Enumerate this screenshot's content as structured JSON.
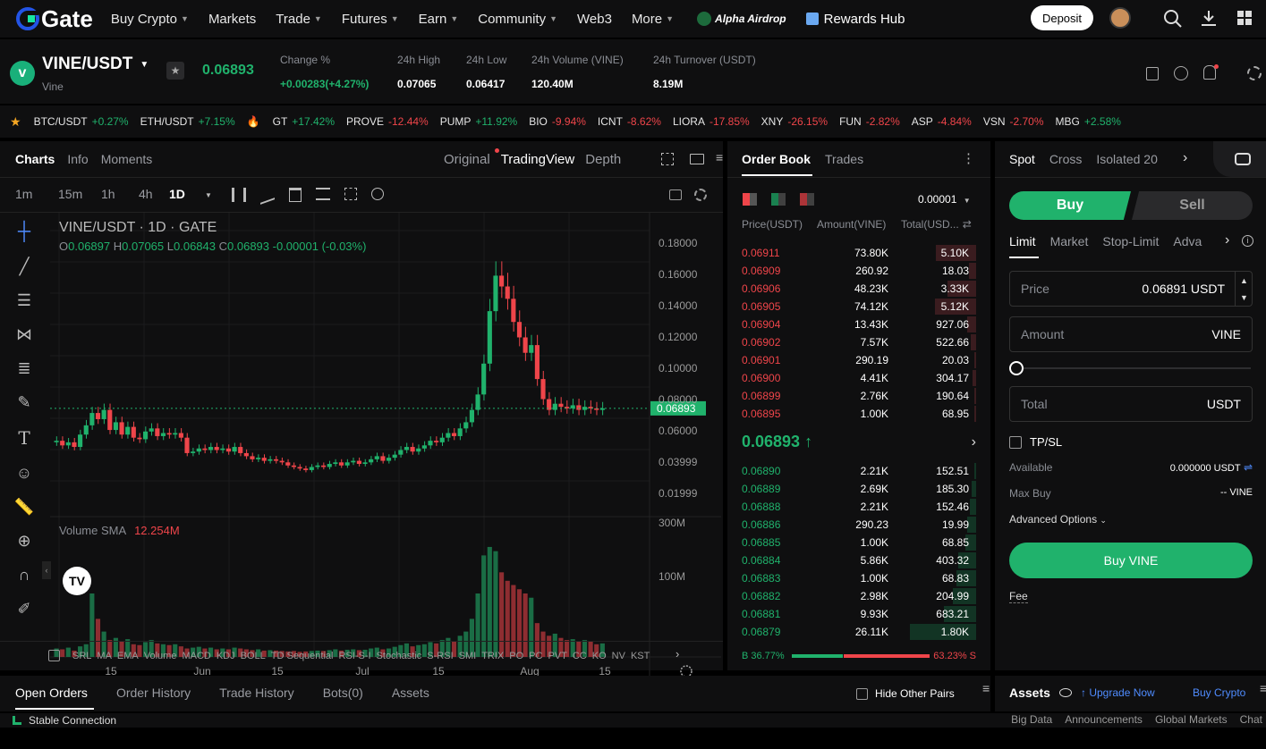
{
  "nav": {
    "logo": "Gate",
    "items": [
      {
        "label": "Buy Crypto",
        "caret": true
      },
      {
        "label": "Markets",
        "caret": false
      },
      {
        "label": "Trade",
        "caret": true
      },
      {
        "label": "Futures",
        "caret": true
      },
      {
        "label": "Earn",
        "caret": true
      },
      {
        "label": "Community",
        "caret": true
      },
      {
        "label": "Web3",
        "caret": false
      },
      {
        "label": "More",
        "caret": true
      }
    ],
    "alpha_airdrop": "Alpha Airdrop",
    "rewards_hub": "Rewards Hub",
    "deposit": "Deposit"
  },
  "pair": {
    "symbol": "VINE/USDT",
    "name": "Vine",
    "price": "0.06893",
    "stats": [
      {
        "label": "Change %",
        "value": "+0.00283(+4.27%)",
        "color": "green"
      },
      {
        "label": "24h High",
        "value": "0.07065",
        "color": "white"
      },
      {
        "label": "24h Low",
        "value": "0.06417",
        "color": "white"
      },
      {
        "label": "24h Volume (VINE)",
        "value": "120.40M",
        "color": "white"
      },
      {
        "label": "24h Turnover (USDT)",
        "value": "8.19M",
        "color": "white"
      }
    ]
  },
  "tickers": [
    {
      "sym": "BTC/USDT",
      "chg": "+0.27%",
      "up": true
    },
    {
      "sym": "ETH/USDT",
      "chg": "+7.15%",
      "up": true
    },
    {
      "sym": "GT",
      "chg": "+17.42%",
      "up": true
    },
    {
      "sym": "PROVE",
      "chg": "-12.44%",
      "up": false
    },
    {
      "sym": "PUMP",
      "chg": "+11.92%",
      "up": true
    },
    {
      "sym": "BIO",
      "chg": "-9.94%",
      "up": false
    },
    {
      "sym": "ICNT",
      "chg": "-8.62%",
      "up": false
    },
    {
      "sym": "LIORA",
      "chg": "-17.85%",
      "up": false
    },
    {
      "sym": "XNY",
      "chg": "-26.15%",
      "up": false
    },
    {
      "sym": "FUN",
      "chg": "-2.82%",
      "up": false
    },
    {
      "sym": "ASP",
      "chg": "-4.84%",
      "up": false
    },
    {
      "sym": "VSN",
      "chg": "-2.70%",
      "up": false
    },
    {
      "sym": "MBG",
      "chg": "+2.58%",
      "up": true
    }
  ],
  "chart": {
    "tabs": [
      "Charts",
      "Info",
      "Moments"
    ],
    "views": [
      "Original",
      "TradingView",
      "Depth"
    ],
    "intervals": [
      "1m",
      "15m",
      "1h",
      "4h",
      "1D"
    ],
    "legend_title": "VINE/USDT · 1D · GATE",
    "ohlc": {
      "o": "0.06897",
      "h": "0.07065",
      "l": "0.06843",
      "c": "0.06893",
      "chg": "-0.00001 (-0.03%)"
    },
    "ohlc_letters": {
      "o": "O",
      "h": "H",
      "l": "L",
      "c": "C"
    },
    "price_ticks": [
      "0.18000",
      "0.16000",
      "0.14000",
      "0.12000",
      "0.10000",
      "0.08000",
      "0.06000",
      "0.03999",
      "0.01999"
    ],
    "last_price_label": "0.06893",
    "volume_label": "Volume SMA",
    "volume_value": "12.254M",
    "volume_ticks": [
      "300M",
      "100M"
    ],
    "x_ticks": [
      "15",
      "Jun",
      "15",
      "Jul",
      "15",
      "Aug",
      "15"
    ],
    "indicators": [
      "SRL",
      "MA",
      "EMA",
      "Volume",
      "MACD",
      "KDJ",
      "BOLL",
      "TD Sequential",
      "RSI-S-I",
      "Stochastic",
      "S-RSI",
      "SMI",
      "TRIX",
      "PO",
      "PC",
      "PVT",
      "CC",
      "KO",
      "NV",
      "KST"
    ]
  },
  "chart_data": {
    "type": "candlestick",
    "ylim": [
      0,
      0.19
    ],
    "closes": [
      0.048,
      0.045,
      0.047,
      0.044,
      0.052,
      0.058,
      0.066,
      0.062,
      0.068,
      0.055,
      0.06,
      0.052,
      0.057,
      0.05,
      0.049,
      0.054,
      0.056,
      0.051,
      0.053,
      0.052,
      0.053,
      0.05,
      0.04,
      0.041,
      0.043,
      0.042,
      0.044,
      0.042,
      0.043,
      0.041,
      0.044,
      0.04,
      0.038,
      0.036,
      0.037,
      0.035,
      0.036,
      0.035,
      0.034,
      0.032,
      0.031,
      0.03,
      0.029,
      0.031,
      0.032,
      0.031,
      0.033,
      0.034,
      0.032,
      0.034,
      0.035,
      0.033,
      0.034,
      0.036,
      0.038,
      0.035,
      0.037,
      0.039,
      0.042,
      0.044,
      0.041,
      0.043,
      0.045,
      0.048,
      0.047,
      0.05,
      0.053,
      0.051,
      0.056,
      0.06,
      0.068,
      0.078,
      0.098,
      0.132,
      0.155,
      0.148,
      0.14,
      0.125,
      0.115,
      0.105,
      0.11,
      0.088,
      0.075,
      0.068,
      0.072,
      0.07,
      0.069,
      0.071,
      0.068,
      0.07,
      0.069,
      0.068,
      0.069
    ],
    "volumes_m": [
      20,
      18,
      22,
      15,
      25,
      30,
      150,
      90,
      60,
      40,
      45,
      38,
      42,
      30,
      28,
      35,
      40,
      32,
      30,
      28,
      30,
      25,
      20,
      22,
      24,
      20,
      22,
      18,
      20,
      18,
      22,
      20,
      18,
      16,
      18,
      15,
      16,
      15,
      14,
      13,
      14,
      12,
      13,
      14,
      15,
      14,
      16,
      18,
      15,
      17,
      18,
      16,
      17,
      20,
      22,
      18,
      20,
      24,
      28,
      32,
      25,
      28,
      30,
      35,
      32,
      40,
      45,
      38,
      50,
      60,
      90,
      150,
      240,
      260,
      250,
      200,
      180,
      170,
      160,
      150,
      140,
      80,
      60,
      50,
      55,
      45,
      40,
      42,
      38,
      40,
      36,
      30,
      32
    ]
  },
  "orderbook": {
    "tabs": [
      "Order Book",
      "Trades"
    ],
    "precision": "0.00001",
    "headers": {
      "price": "Price(USDT)",
      "amount": "Amount(VINE)",
      "total": "Total(USD..."
    },
    "asks": [
      {
        "p": "0.06911",
        "a": "73.80K",
        "t": "5.10K",
        "d": 0.56
      },
      {
        "p": "0.06909",
        "a": "260.92",
        "t": "18.03",
        "d": 0.1
      },
      {
        "p": "0.06906",
        "a": "48.23K",
        "t": "3.33K",
        "d": 0.4
      },
      {
        "p": "0.06905",
        "a": "74.12K",
        "t": "5.12K",
        "d": 0.57
      },
      {
        "p": "0.06904",
        "a": "13.43K",
        "t": "927.06",
        "d": 0.12
      },
      {
        "p": "0.06902",
        "a": "7.57K",
        "t": "522.66",
        "d": 0.08
      },
      {
        "p": "0.06901",
        "a": "290.19",
        "t": "20.03",
        "d": 0.03
      },
      {
        "p": "0.06900",
        "a": "4.41K",
        "t": "304.17",
        "d": 0.05
      },
      {
        "p": "0.06899",
        "a": "2.76K",
        "t": "190.64",
        "d": 0.03
      },
      {
        "p": "0.06895",
        "a": "1.00K",
        "t": "68.95",
        "d": 0.02
      }
    ],
    "mid_price": "0.06893",
    "bids": [
      {
        "p": "0.06890",
        "a": "2.21K",
        "t": "152.51",
        "d": 0.03
      },
      {
        "p": "0.06889",
        "a": "2.69K",
        "t": "185.30",
        "d": 0.06
      },
      {
        "p": "0.06888",
        "a": "2.21K",
        "t": "152.46",
        "d": 0.09
      },
      {
        "p": "0.06886",
        "a": "290.23",
        "t": "19.99",
        "d": 0.12
      },
      {
        "p": "0.06885",
        "a": "1.00K",
        "t": "68.85",
        "d": 0.15
      },
      {
        "p": "0.06884",
        "a": "5.86K",
        "t": "403.32",
        "d": 0.25
      },
      {
        "p": "0.06883",
        "a": "1.00K",
        "t": "68.83",
        "d": 0.28
      },
      {
        "p": "0.06882",
        "a": "2.98K",
        "t": "204.99",
        "d": 0.33
      },
      {
        "p": "0.06881",
        "a": "9.93K",
        "t": "683.21",
        "d": 0.45
      },
      {
        "p": "0.06879",
        "a": "26.11K",
        "t": "1.80K",
        "d": 0.92
      }
    ],
    "buy_ratio": "B 36.77%",
    "sell_ratio": "63.23% S",
    "buy_fraction": 0.3677
  },
  "trade": {
    "modes": [
      "Spot",
      "Cross",
      "Isolated 20"
    ],
    "buy": "Buy",
    "sell": "Sell",
    "order_types": [
      "Limit",
      "Market",
      "Stop-Limit",
      "Adva"
    ],
    "price_label": "Price",
    "price_value": "0.06891 USDT",
    "amount_label": "Amount",
    "amount_unit": "VINE",
    "total_label": "Total",
    "total_unit": "USDT",
    "tpsl": "TP/SL",
    "available_label": "Available",
    "available_value": "0.000000 USDT",
    "maxbuy_label": "Max Buy",
    "maxbuy_value": "-- VINE",
    "advanced": "Advanced Options",
    "submit": "Buy VINE",
    "fee": "Fee"
  },
  "bottom": {
    "tabs": [
      "Open Orders",
      "Order History",
      "Trade History",
      "Bots(0)",
      "Assets"
    ],
    "hide_other": "Hide Other Pairs",
    "assets": "Assets",
    "upgrade": "Upgrade Now",
    "buy_crypto": "Buy Crypto"
  },
  "status": {
    "connection": "Stable Connection",
    "links": [
      "Big Data",
      "Announcements",
      "Global Markets",
      "Chat"
    ]
  },
  "colors": {
    "up": "#20b26c",
    "down": "#ef454a",
    "bg": "#0f0f10"
  }
}
